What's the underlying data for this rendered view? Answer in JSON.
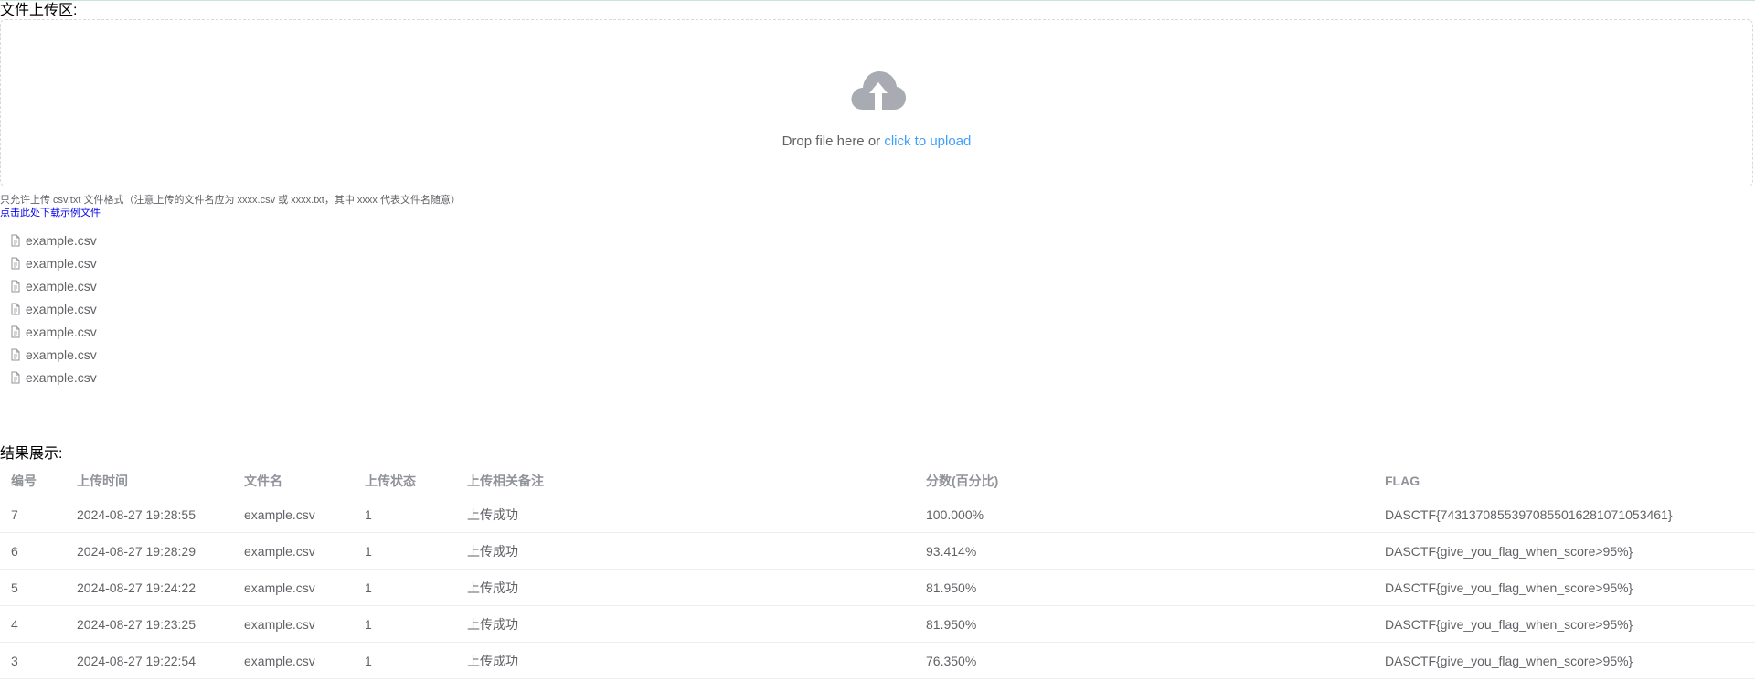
{
  "upload": {
    "title": "文件上传区:",
    "drop_text": "Drop file here or ",
    "drop_link": "click to upload",
    "tip": "只允许上传 csv,txt 文件格式（注意上传的文件名应为 xxxx.csv 或 xxxx.txt，其中 xxxx 代表文件名随意）",
    "download_link": "点击此处下载示例文件",
    "files": [
      "example.csv",
      "example.csv",
      "example.csv",
      "example.csv",
      "example.csv",
      "example.csv",
      "example.csv"
    ]
  },
  "results": {
    "title": "结果展示:",
    "columns": [
      "编号",
      "上传时间",
      "文件名",
      "上传状态",
      "上传相关备注",
      "分数(百分比)",
      "FLAG"
    ],
    "rows": [
      [
        "7",
        "2024-08-27 19:28:55",
        "example.csv",
        "1",
        "上传成功",
        "100.000%",
        "DASCTF{74313708553970855016281071053461}"
      ],
      [
        "6",
        "2024-08-27 19:28:29",
        "example.csv",
        "1",
        "上传成功",
        "93.414%",
        "DASCTF{give_you_flag_when_score>95%}"
      ],
      [
        "5",
        "2024-08-27 19:24:22",
        "example.csv",
        "1",
        "上传成功",
        "81.950%",
        "DASCTF{give_you_flag_when_score>95%}"
      ],
      [
        "4",
        "2024-08-27 19:23:25",
        "example.csv",
        "1",
        "上传成功",
        "81.950%",
        "DASCTF{give_you_flag_when_score>95%}"
      ],
      [
        "3",
        "2024-08-27 19:22:54",
        "example.csv",
        "1",
        "上传成功",
        "76.350%",
        "DASCTF{give_you_flag_when_score>95%}"
      ]
    ]
  },
  "icons": {
    "upload": "cloud-upload-icon",
    "file": "document-icon"
  },
  "colors": {
    "link": "#409eff",
    "icon": "#a8abb2",
    "text": "#606266",
    "header": "#909399",
    "border": "#ebeef5"
  }
}
